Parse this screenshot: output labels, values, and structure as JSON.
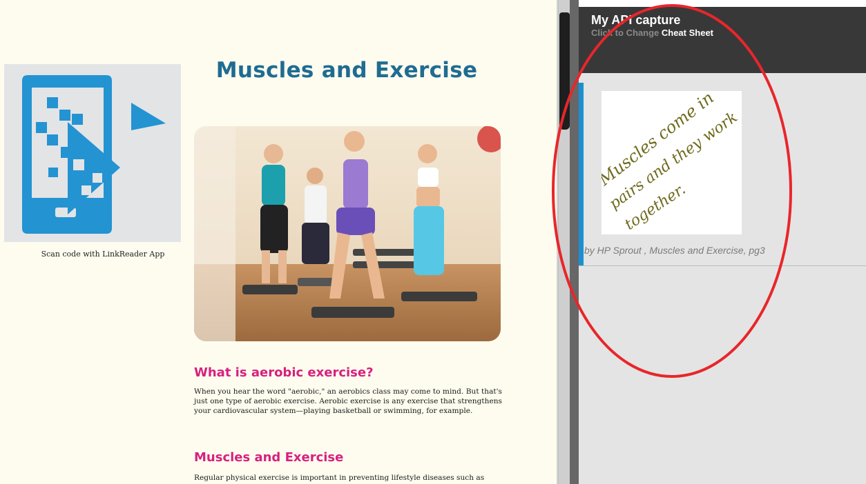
{
  "document": {
    "qr_caption": "Scan code with LinkReader App",
    "title": "Muscles and Exercise",
    "section1_heading": "What is aerobic exercise?",
    "section1_text": "When you hear the word \"aerobic,\" an aerobics class may come to mind. But that's just one type of aerobic exercise. Aerobic exercise is any exercise that strengthens your cardiovascular system—playing basketball or swimming, for example.",
    "section2_heading": "Muscles and Exercise",
    "section2_text": "Regular physical exercise is important in preventing lifestyle diseases such as",
    "logo_icon": "linkreader-logo-icon",
    "photo_icon": "aerobics-class-photo"
  },
  "panel": {
    "title": "My API capture",
    "subtitle_muted": "Click to Change",
    "subtitle_strong": "Cheat Sheet",
    "capture": {
      "handwriting_lines": [
        "Muscles come in",
        "pairs and they work",
        "together."
      ],
      "caption": "by HP Sprout , Muscles and Exercise, pg3"
    }
  },
  "colors": {
    "page_background": "#fdfcef",
    "title_blue": "#1f6c92",
    "heading_pink": "#d8207f",
    "panel_header": "#383838",
    "panel_body": "#e4e4e4",
    "selection_bar": "#1d8fd1",
    "annotation_red": "#e8262b",
    "logo_blue": "#2393d2"
  }
}
